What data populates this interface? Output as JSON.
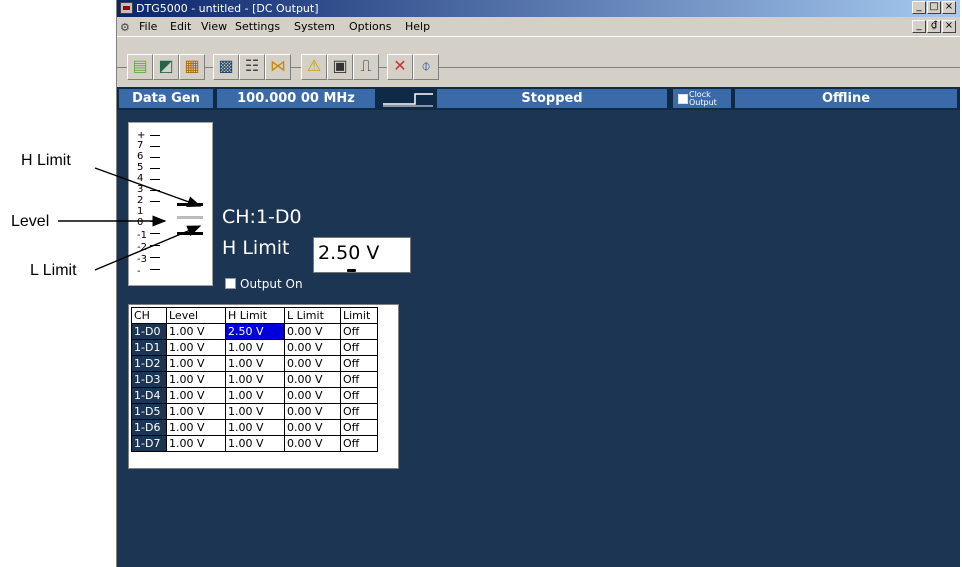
{
  "callouts": {
    "h_limit": "H Limit",
    "level": "Level",
    "l_limit": "L Limit"
  },
  "window": {
    "title": "DTG5000 - untitled - [DC Output]",
    "buttons": {
      "minimize": "_",
      "maximize": "□",
      "close": "×",
      "restore": "₫"
    }
  },
  "menu": {
    "items": [
      "File",
      "Edit",
      "View",
      "Settings",
      "System",
      "Options",
      "Help"
    ]
  },
  "toolbar": {
    "icons": [
      "setup-icon",
      "timing-icon",
      "data-listing-icon",
      "waveform-icon",
      "pattern-icon",
      "sequence-icon",
      "alert-icon",
      "group-icon",
      "output-icon",
      "run-icon",
      "probe-icon"
    ]
  },
  "status": {
    "mode": "Data Gen",
    "frequency": "100.000 00 MHz",
    "run_state": "Stopped",
    "clock_output_line1": "Clock",
    "clock_output_line2": "Output",
    "connection": "Offline"
  },
  "scale": {
    "labels": [
      "+",
      "7",
      "6",
      "5",
      "4",
      "3",
      "2",
      "1",
      "0",
      "-1",
      "-2",
      "-3",
      "-"
    ]
  },
  "editor": {
    "channel": "CH:1-D0",
    "parameter": "H Limit",
    "value": "2.50 V",
    "output_checkbox_label": "Output On",
    "output_on": false
  },
  "table": {
    "headers": [
      "CH",
      "Level",
      "H Limit",
      "L Limit",
      "Limit"
    ],
    "rows": [
      [
        "1-D0",
        "1.00 V",
        "2.50 V",
        "0.00 V",
        "Off"
      ],
      [
        "1-D1",
        "1.00 V",
        "1.00 V",
        "0.00 V",
        "Off"
      ],
      [
        "1-D2",
        "1.00 V",
        "1.00 V",
        "0.00 V",
        "Off"
      ],
      [
        "1-D3",
        "1.00 V",
        "1.00 V",
        "0.00 V",
        "Off"
      ],
      [
        "1-D4",
        "1.00 V",
        "1.00 V",
        "0.00 V",
        "Off"
      ],
      [
        "1-D5",
        "1.00 V",
        "1.00 V",
        "0.00 V",
        "Off"
      ],
      [
        "1-D6",
        "1.00 V",
        "1.00 V",
        "0.00 V",
        "Off"
      ],
      [
        "1-D7",
        "1.00 V",
        "1.00 V",
        "0.00 V",
        "Off"
      ]
    ],
    "selected_row": 0,
    "selected_col": 2
  },
  "colors": {
    "titlebar_start": "#0a246a",
    "status_segment": "#3a6aa8",
    "main_background": "#1b3553",
    "selected_cell": "#0000dd"
  }
}
